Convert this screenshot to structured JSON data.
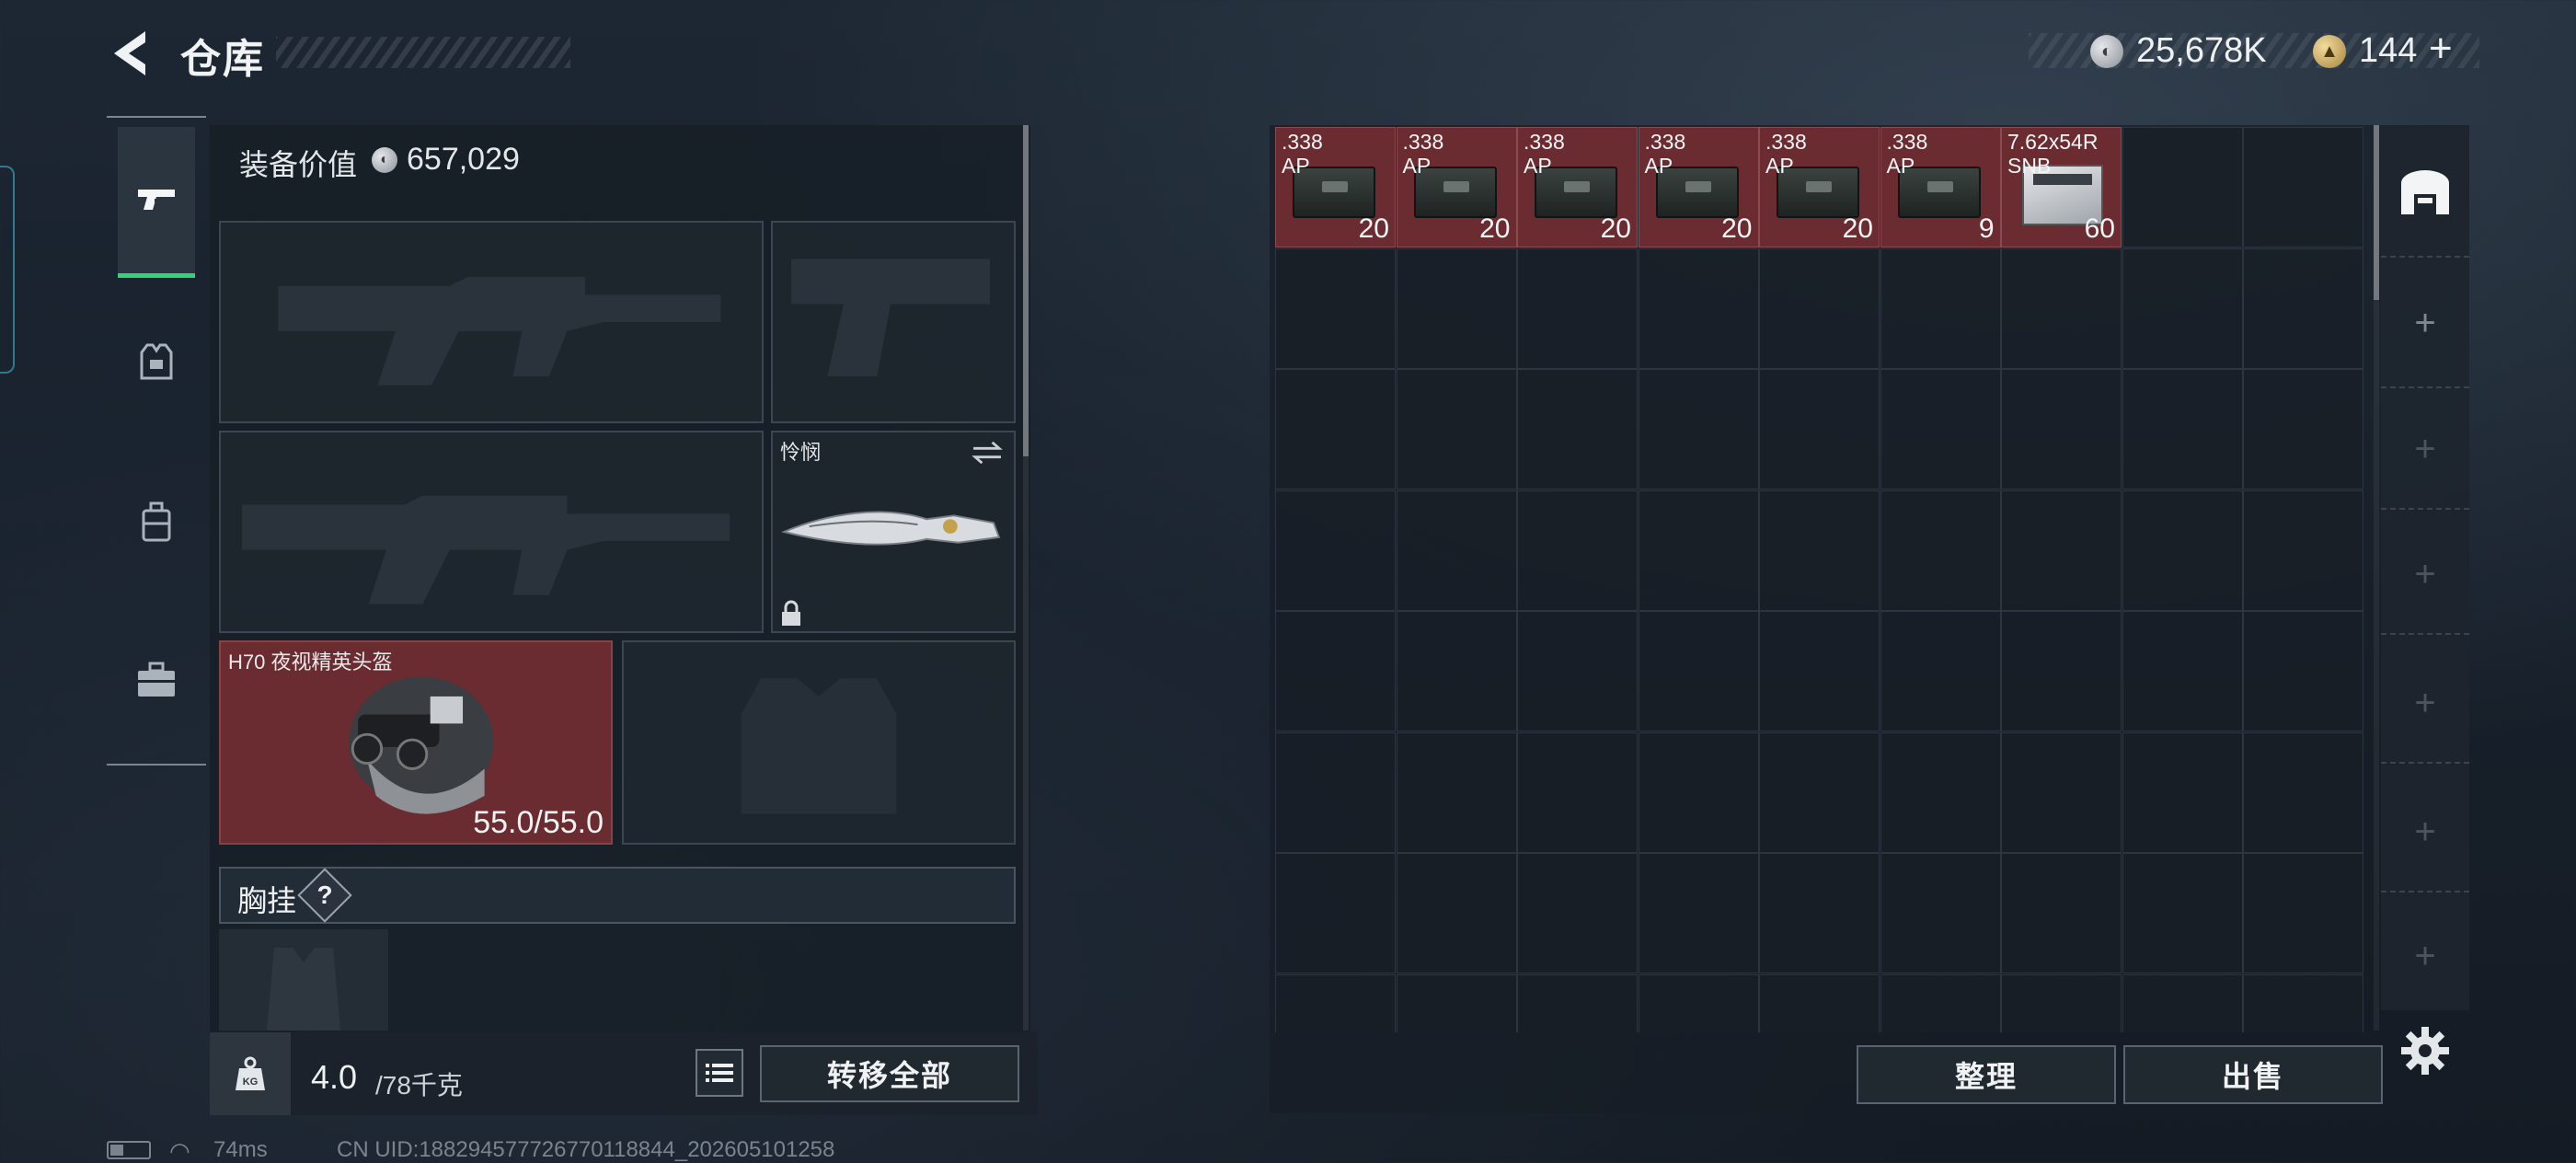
{
  "header": {
    "title": "仓库",
    "currency_silver": "25,678K",
    "currency_gold": "144",
    "plus_label": "+"
  },
  "left_rail": {
    "items": [
      {
        "name": "weapons",
        "icon": "pistol-icon",
        "active": true
      },
      {
        "name": "armor",
        "icon": "vest-icon",
        "active": false
      },
      {
        "name": "backpack",
        "icon": "backpack-icon",
        "active": false
      },
      {
        "name": "tools",
        "icon": "toolbox-icon",
        "active": false
      }
    ]
  },
  "loadout": {
    "value_label": "装备价值",
    "value_amount": "657,029",
    "melee_name": "怜悯",
    "helmet_name": "H70 夜视精英头盔",
    "helmet_durability": "55.0/55.0",
    "chest_label": "胸挂",
    "chest_help": "?"
  },
  "bottom_bar": {
    "weight_current": "4.0",
    "weight_max": "/78千克",
    "transfer_all": "转移全部"
  },
  "storage": {
    "items": [
      {
        "name": ".338\nAP",
        "count": "20",
        "type": "ammo-box"
      },
      {
        "name": ".338\nAP",
        "count": "20",
        "type": "ammo-box"
      },
      {
        "name": ".338\nAP",
        "count": "20",
        "type": "ammo-box"
      },
      {
        "name": ".338\nAP",
        "count": "20",
        "type": "ammo-box"
      },
      {
        "name": ".338\nAP",
        "count": "20",
        "type": "ammo-box"
      },
      {
        "name": ".338\nAP",
        "count": "9",
        "type": "ammo-box"
      },
      {
        "name": "7.62x54R\nSNB",
        "count": "60",
        "type": "sn-box"
      }
    ],
    "sort_label": "整理",
    "sell_label": "出售"
  },
  "status_bar": {
    "ping": "74ms",
    "uid": "CN UID:18829457772677011884​4_202605101258"
  },
  "colors": {
    "item_red": "#6b2c31",
    "active_green": "#34d07a",
    "panel": "#161d25"
  }
}
